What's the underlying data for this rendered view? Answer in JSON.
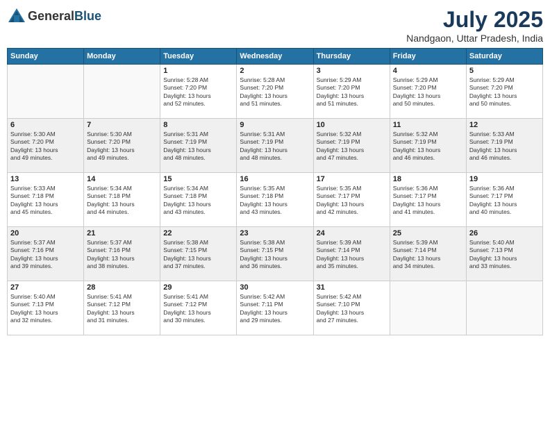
{
  "header": {
    "logo_general": "General",
    "logo_blue": "Blue",
    "month": "July 2025",
    "location": "Nandgaon, Uttar Pradesh, India"
  },
  "days_of_week": [
    "Sunday",
    "Monday",
    "Tuesday",
    "Wednesday",
    "Thursday",
    "Friday",
    "Saturday"
  ],
  "weeks": [
    [
      {
        "day": "",
        "info": ""
      },
      {
        "day": "",
        "info": ""
      },
      {
        "day": "1",
        "info": "Sunrise: 5:28 AM\nSunset: 7:20 PM\nDaylight: 13 hours\nand 52 minutes."
      },
      {
        "day": "2",
        "info": "Sunrise: 5:28 AM\nSunset: 7:20 PM\nDaylight: 13 hours\nand 51 minutes."
      },
      {
        "day": "3",
        "info": "Sunrise: 5:29 AM\nSunset: 7:20 PM\nDaylight: 13 hours\nand 51 minutes."
      },
      {
        "day": "4",
        "info": "Sunrise: 5:29 AM\nSunset: 7:20 PM\nDaylight: 13 hours\nand 50 minutes."
      },
      {
        "day": "5",
        "info": "Sunrise: 5:29 AM\nSunset: 7:20 PM\nDaylight: 13 hours\nand 50 minutes."
      }
    ],
    [
      {
        "day": "6",
        "info": "Sunrise: 5:30 AM\nSunset: 7:20 PM\nDaylight: 13 hours\nand 49 minutes."
      },
      {
        "day": "7",
        "info": "Sunrise: 5:30 AM\nSunset: 7:20 PM\nDaylight: 13 hours\nand 49 minutes."
      },
      {
        "day": "8",
        "info": "Sunrise: 5:31 AM\nSunset: 7:19 PM\nDaylight: 13 hours\nand 48 minutes."
      },
      {
        "day": "9",
        "info": "Sunrise: 5:31 AM\nSunset: 7:19 PM\nDaylight: 13 hours\nand 48 minutes."
      },
      {
        "day": "10",
        "info": "Sunrise: 5:32 AM\nSunset: 7:19 PM\nDaylight: 13 hours\nand 47 minutes."
      },
      {
        "day": "11",
        "info": "Sunrise: 5:32 AM\nSunset: 7:19 PM\nDaylight: 13 hours\nand 46 minutes."
      },
      {
        "day": "12",
        "info": "Sunrise: 5:33 AM\nSunset: 7:19 PM\nDaylight: 13 hours\nand 46 minutes."
      }
    ],
    [
      {
        "day": "13",
        "info": "Sunrise: 5:33 AM\nSunset: 7:18 PM\nDaylight: 13 hours\nand 45 minutes."
      },
      {
        "day": "14",
        "info": "Sunrise: 5:34 AM\nSunset: 7:18 PM\nDaylight: 13 hours\nand 44 minutes."
      },
      {
        "day": "15",
        "info": "Sunrise: 5:34 AM\nSunset: 7:18 PM\nDaylight: 13 hours\nand 43 minutes."
      },
      {
        "day": "16",
        "info": "Sunrise: 5:35 AM\nSunset: 7:18 PM\nDaylight: 13 hours\nand 43 minutes."
      },
      {
        "day": "17",
        "info": "Sunrise: 5:35 AM\nSunset: 7:17 PM\nDaylight: 13 hours\nand 42 minutes."
      },
      {
        "day": "18",
        "info": "Sunrise: 5:36 AM\nSunset: 7:17 PM\nDaylight: 13 hours\nand 41 minutes."
      },
      {
        "day": "19",
        "info": "Sunrise: 5:36 AM\nSunset: 7:17 PM\nDaylight: 13 hours\nand 40 minutes."
      }
    ],
    [
      {
        "day": "20",
        "info": "Sunrise: 5:37 AM\nSunset: 7:16 PM\nDaylight: 13 hours\nand 39 minutes."
      },
      {
        "day": "21",
        "info": "Sunrise: 5:37 AM\nSunset: 7:16 PM\nDaylight: 13 hours\nand 38 minutes."
      },
      {
        "day": "22",
        "info": "Sunrise: 5:38 AM\nSunset: 7:15 PM\nDaylight: 13 hours\nand 37 minutes."
      },
      {
        "day": "23",
        "info": "Sunrise: 5:38 AM\nSunset: 7:15 PM\nDaylight: 13 hours\nand 36 minutes."
      },
      {
        "day": "24",
        "info": "Sunrise: 5:39 AM\nSunset: 7:14 PM\nDaylight: 13 hours\nand 35 minutes."
      },
      {
        "day": "25",
        "info": "Sunrise: 5:39 AM\nSunset: 7:14 PM\nDaylight: 13 hours\nand 34 minutes."
      },
      {
        "day": "26",
        "info": "Sunrise: 5:40 AM\nSunset: 7:13 PM\nDaylight: 13 hours\nand 33 minutes."
      }
    ],
    [
      {
        "day": "27",
        "info": "Sunrise: 5:40 AM\nSunset: 7:13 PM\nDaylight: 13 hours\nand 32 minutes."
      },
      {
        "day": "28",
        "info": "Sunrise: 5:41 AM\nSunset: 7:12 PM\nDaylight: 13 hours\nand 31 minutes."
      },
      {
        "day": "29",
        "info": "Sunrise: 5:41 AM\nSunset: 7:12 PM\nDaylight: 13 hours\nand 30 minutes."
      },
      {
        "day": "30",
        "info": "Sunrise: 5:42 AM\nSunset: 7:11 PM\nDaylight: 13 hours\nand 29 minutes."
      },
      {
        "day": "31",
        "info": "Sunrise: 5:42 AM\nSunset: 7:10 PM\nDaylight: 13 hours\nand 27 minutes."
      },
      {
        "day": "",
        "info": ""
      },
      {
        "day": "",
        "info": ""
      }
    ]
  ]
}
